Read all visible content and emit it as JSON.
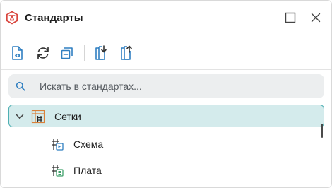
{
  "header": {
    "title": "Стандарты",
    "icon": "standards-logo-icon",
    "maximize_icon": "maximize-icon",
    "close_icon": "close-icon"
  },
  "toolbar": {
    "buttons": [
      {
        "name": "view-document-button",
        "icon": "document-eye-icon"
      },
      {
        "name": "refresh-button",
        "icon": "refresh-icon"
      },
      {
        "name": "collapse-all-button",
        "icon": "collapse-icon"
      },
      {
        "name": "import-button",
        "icon": "import-icon"
      },
      {
        "name": "export-button",
        "icon": "export-icon"
      }
    ]
  },
  "search": {
    "placeholder": "Искать в стандартах...",
    "value": ""
  },
  "tree": {
    "root": {
      "label": "Сетки",
      "expanded": true,
      "icon": "grid-icon"
    },
    "children": [
      {
        "label": "Схема",
        "icon": "schematic-grid-icon"
      },
      {
        "label": "Плата",
        "icon": "board-grid-icon"
      }
    ]
  },
  "colors": {
    "accent": "#4fb0b3",
    "selected_bg": "#d4ebec",
    "logo_red": "#d9473f",
    "grid_orange": "#d9813a",
    "icon_blue": "#2f7fc1",
    "icon_green": "#3fa06a"
  }
}
